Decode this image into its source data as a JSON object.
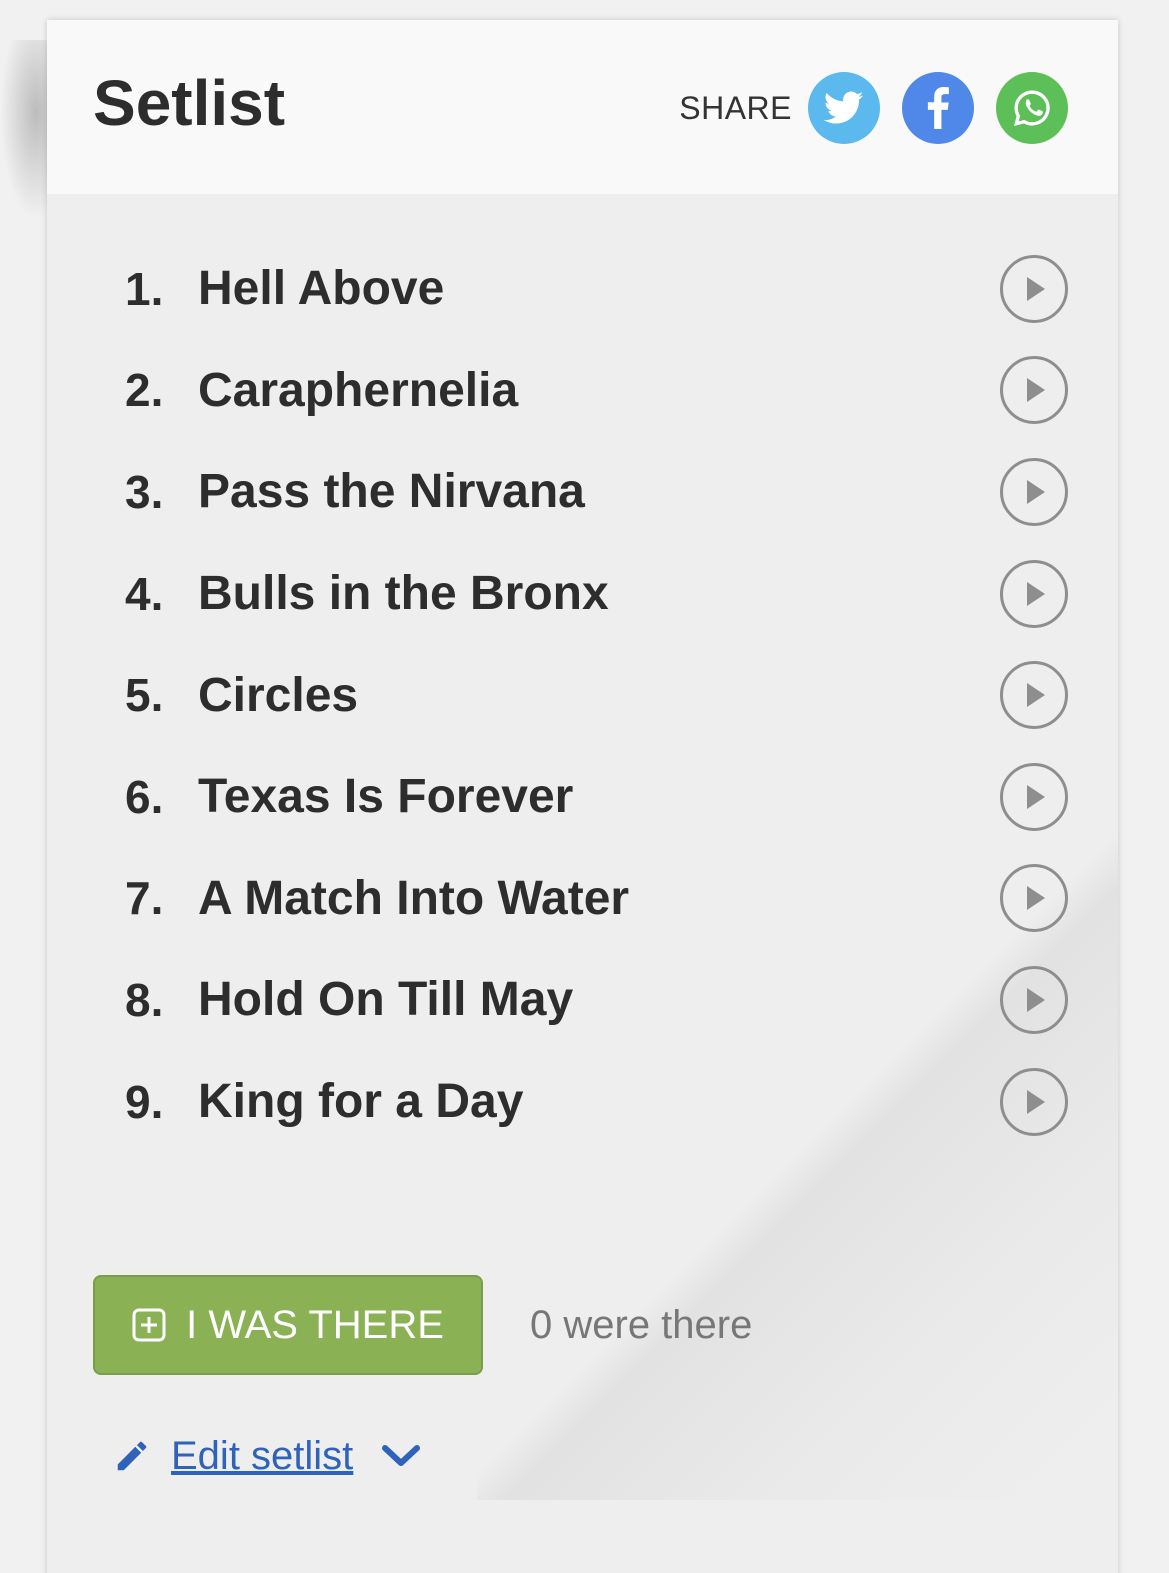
{
  "header": {
    "title": "Setlist",
    "share_label": "SHARE",
    "share_buttons": [
      {
        "icon": "twitter-icon",
        "color": "#5bb9ee"
      },
      {
        "icon": "facebook-icon",
        "color": "#4f88e8"
      },
      {
        "icon": "whatsapp-icon",
        "color": "#5cbf58"
      }
    ]
  },
  "setlist": {
    "songs": [
      {
        "number": "1.",
        "title": "Hell Above"
      },
      {
        "number": "2.",
        "title": "Caraphernelia"
      },
      {
        "number": "3.",
        "title": "Pass the Nirvana"
      },
      {
        "number": "4.",
        "title": "Bulls in the Bronx"
      },
      {
        "number": "5.",
        "title": "Circles"
      },
      {
        "number": "6.",
        "title": "Texas Is Forever"
      },
      {
        "number": "7.",
        "title": "A Match Into Water"
      },
      {
        "number": "8.",
        "title": "Hold On Till May"
      },
      {
        "number": "9.",
        "title": "King for a Day"
      }
    ]
  },
  "actions": {
    "was_there_label": "I WAS THERE",
    "was_there_count": "0 were there",
    "edit_label": "Edit setlist"
  },
  "colors": {
    "accent_green": "#8bb155",
    "link_blue": "#2f63b9"
  }
}
